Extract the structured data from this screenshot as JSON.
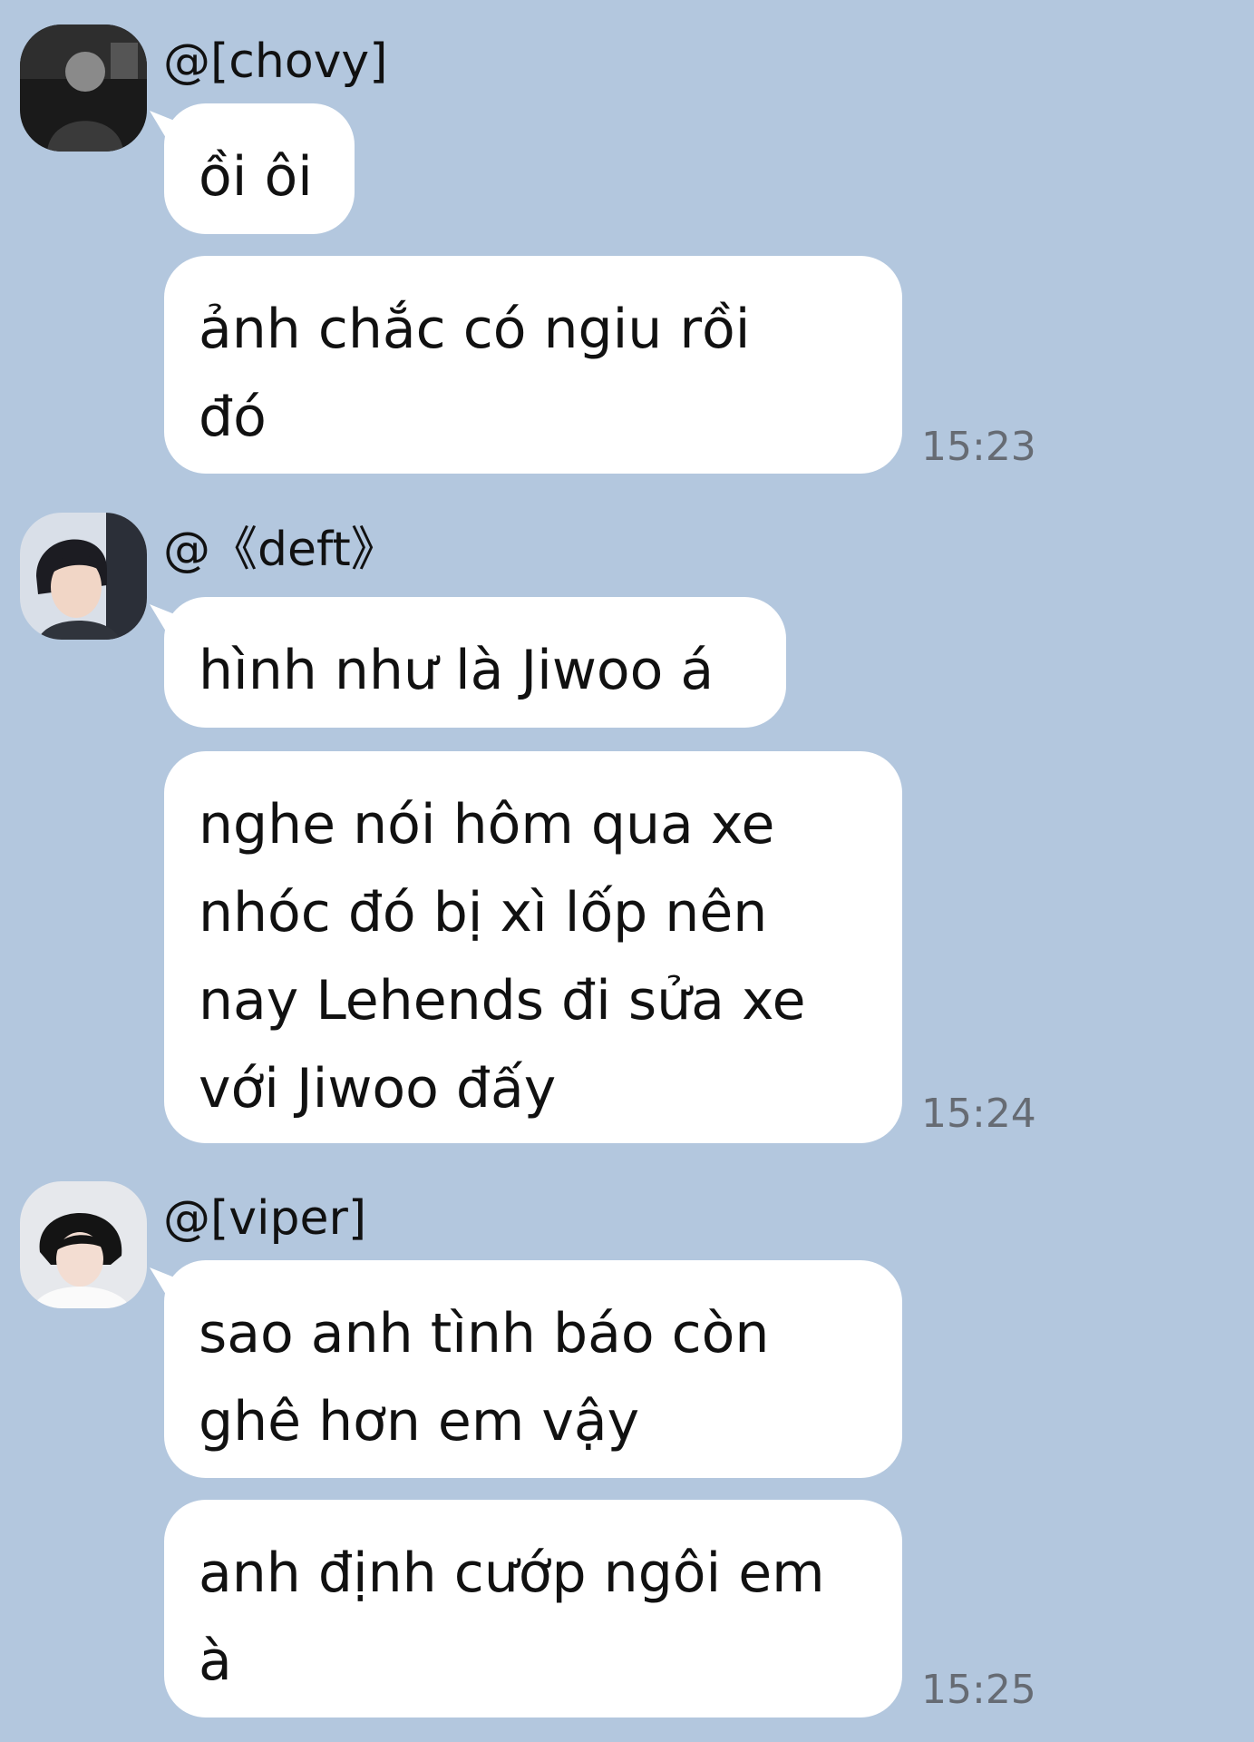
{
  "messages": [
    {
      "sender": "@[chovy]",
      "avatar_icon": "user-avatar-chovy",
      "bubbles": [
        [
          "ồi ôi"
        ],
        [
          "ảnh chắc có ngiu rồi",
          "đó"
        ]
      ],
      "time": "15:23"
    },
    {
      "sender": "@《deft》",
      "avatar_icon": "user-avatar-deft",
      "bubbles": [
        [
          "hình như là Jiwoo á"
        ],
        [
          "nghe nói hôm qua xe",
          "nhóc đó bị xì lốp nên",
          "nay Lehends đi sửa xe",
          "với Jiwoo đấy"
        ]
      ],
      "time": "15:24"
    },
    {
      "sender": "@[viper]",
      "avatar_icon": "user-avatar-viper",
      "bubbles": [
        [
          "sao anh tình báo còn",
          "ghê hơn em vậy"
        ],
        [
          "anh định cướp ngôi em",
          "à"
        ]
      ],
      "time": "15:25"
    }
  ],
  "colors": {
    "background": "#b3c7de",
    "bubble": "#ffffff",
    "text": "#111111",
    "timestamp": "#666b73"
  }
}
